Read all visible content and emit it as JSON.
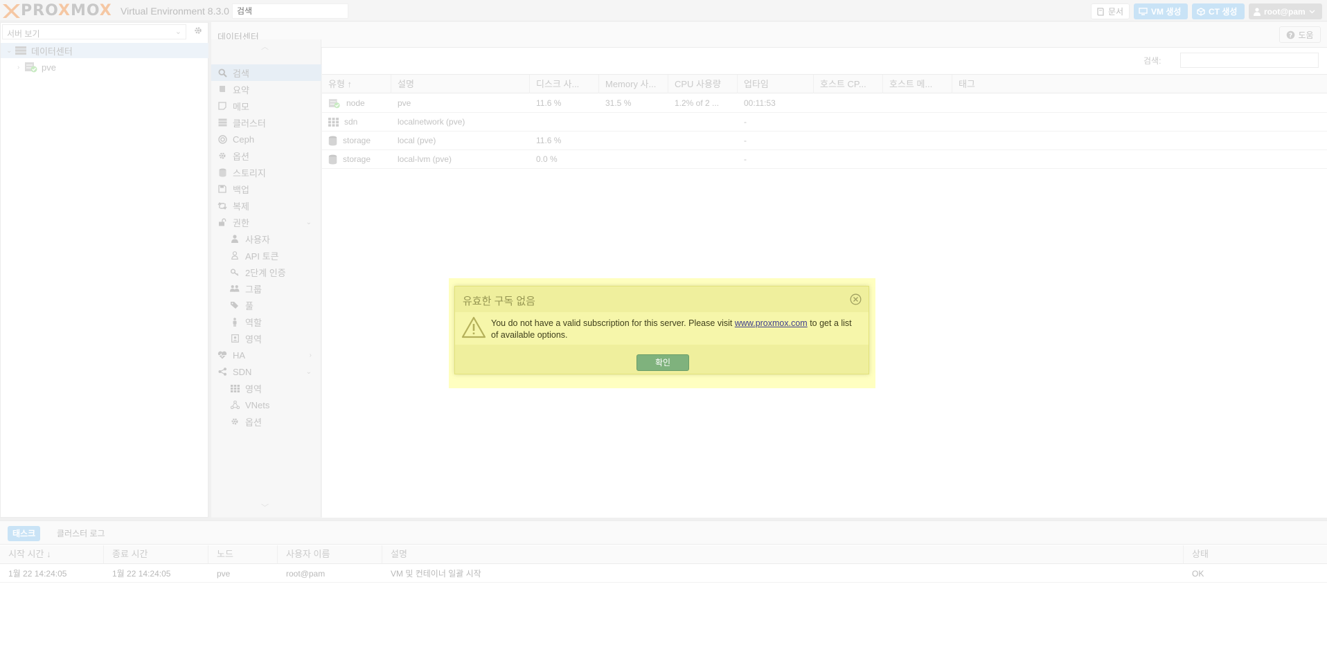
{
  "topbar": {
    "brand_parts": [
      "",
      "PRO",
      "X",
      "MO",
      "X"
    ],
    "version": "Virtual Environment 8.3.0",
    "search_placeholder": "검색",
    "docs_label": "문서",
    "create_vm_label": "VM 생성",
    "create_ct_label": "CT 생성",
    "user_label": "root@pam"
  },
  "left_panel": {
    "view_label": "서버 보기",
    "tree": [
      {
        "label": "데이터센터",
        "icon": "datacenter-icon"
      },
      {
        "label": "pve",
        "icon": "node-online-icon"
      }
    ]
  },
  "content_header": {
    "title": "데이터센터",
    "help_label": "도움"
  },
  "nav": {
    "items": [
      {
        "label": "검색",
        "icon": "search-icon",
        "active": true
      },
      {
        "label": "요약",
        "icon": "book-icon"
      },
      {
        "label": "메모",
        "icon": "note-icon"
      },
      {
        "label": "클러스터",
        "icon": "server-icon"
      },
      {
        "label": "Ceph",
        "icon": "ceph-icon"
      },
      {
        "label": "옵션",
        "icon": "gear-icon"
      },
      {
        "label": "스토리지",
        "icon": "database-icon"
      },
      {
        "label": "백업",
        "icon": "floppy-icon"
      },
      {
        "label": "복제",
        "icon": "retweet-icon"
      },
      {
        "label": "권한",
        "icon": "unlock-icon",
        "expanded": true
      },
      {
        "label": "사용자",
        "icon": "user-icon",
        "sub": true
      },
      {
        "label": "API 토큰",
        "icon": "user-outline-icon",
        "sub": true
      },
      {
        "label": "2단계 인증",
        "icon": "key-icon",
        "sub": true
      },
      {
        "label": "그룹",
        "icon": "users-icon",
        "sub": true
      },
      {
        "label": "풀",
        "icon": "tags-icon",
        "sub": true
      },
      {
        "label": "역할",
        "icon": "male-icon",
        "sub": true
      },
      {
        "label": "영역",
        "icon": "id-badge-icon",
        "sub": true
      },
      {
        "label": "HA",
        "icon": "heartbeat-icon",
        "collapsed": true
      },
      {
        "label": "SDN",
        "icon": "sdn-icon",
        "expanded": true
      },
      {
        "label": "영역",
        "icon": "grid-icon",
        "sub": true
      },
      {
        "label": "VNets",
        "icon": "network-icon",
        "sub": true
      },
      {
        "label": "옵션",
        "icon": "gear-icon",
        "sub": true
      }
    ]
  },
  "resource_grid": {
    "search_label": "검색:",
    "columns": [
      "유형 ↑",
      "설명",
      "디스크 사...",
      "Memory 사...",
      "CPU 사용량",
      "업타임",
      "호스트 CP...",
      "호스트 메...",
      "태그"
    ],
    "rows": [
      {
        "type": "node",
        "icon": "node-online-icon",
        "desc": "pve",
        "disk": "11.6 %",
        "mem": "31.5 %",
        "cpu": "1.2% of 2 ...",
        "uptime": "00:11:53"
      },
      {
        "type": "sdn",
        "icon": "grid-icon",
        "desc": "localnetwork (pve)",
        "disk": "",
        "mem": "",
        "cpu": "",
        "uptime": "-"
      },
      {
        "type": "storage",
        "icon": "database-icon",
        "desc": "local (pve)",
        "disk": "11.6 %",
        "mem": "",
        "cpu": "",
        "uptime": "-"
      },
      {
        "type": "storage",
        "icon": "database-icon",
        "desc": "local-lvm (pve)",
        "disk": "0.0 %",
        "mem": "",
        "cpu": "",
        "uptime": "-"
      }
    ]
  },
  "bottom": {
    "tabs": [
      "태스크",
      "클러스터 로그"
    ],
    "columns": [
      "시작 시간 ↓",
      "종료 시간",
      "노드",
      "사용자 이름",
      "설명",
      "상태"
    ],
    "rows": [
      {
        "start": "1월 22 14:24:05",
        "end": "1월 22 14:24:05",
        "node": "pve",
        "user": "root@pam",
        "desc": "VM 및 컨테이너 일괄 시작",
        "status": "OK"
      }
    ]
  },
  "dialog": {
    "title": "유효한 구독 없음",
    "message_pre": "You do not have a valid subscription for this server. Please visit ",
    "link_text": "www.proxmox.com",
    "message_post": " to get a list of available options.",
    "ok_label": "확인"
  },
  "colors": {
    "accent": "#c9e3f6",
    "dialog_bg": "#efef9d",
    "ok_button": "#7fb27d",
    "logo_orange": "#f5c7a3"
  }
}
